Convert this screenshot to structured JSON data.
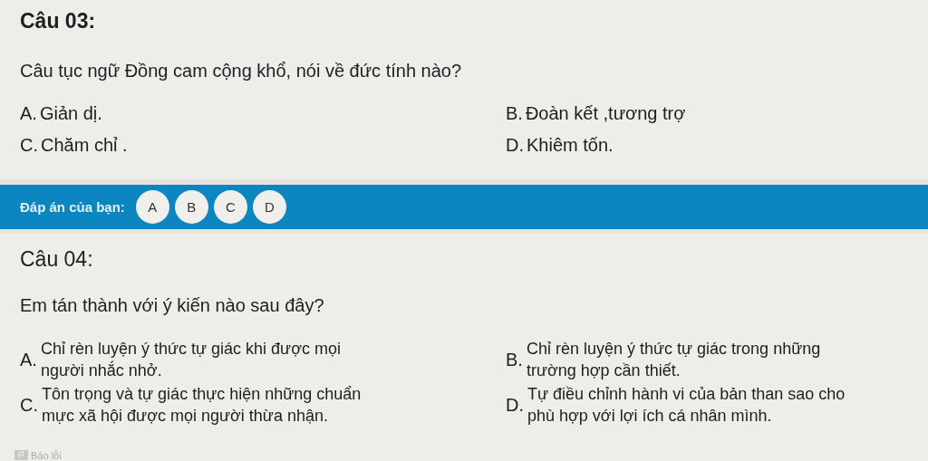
{
  "questions": [
    {
      "title": "Câu 03:",
      "title_bold": true,
      "prompt": "Câu tục ngữ Đồng cam cộng khổ, nói về đức tính nào?",
      "kind": "short",
      "options": [
        {
          "letter": "A.",
          "text": "Giản dị."
        },
        {
          "letter": "B.",
          "text": "Đoàn kết ,tương trợ"
        },
        {
          "letter": "C.",
          "text": "Chăm chỉ ."
        },
        {
          "letter": "D.",
          "text": "Khiêm tốn."
        }
      ]
    },
    {
      "title": "Câu 04:",
      "title_bold": false,
      "prompt": "Em tán thành với ý kiến nào sau đây?",
      "kind": "long",
      "options": [
        {
          "letter": "A.",
          "text": "Chỉ rèn luyện ý thức tự giác khi được mọi người nhắc nhở."
        },
        {
          "letter": "B.",
          "text": "Chỉ rèn luyện ý thức tự giác trong những trường hợp cần thiết."
        },
        {
          "letter": "C.",
          "text": "Tôn trọng và tự giác thực hiện những chuẩn mực xã hội được mọi người thừa nhận."
        },
        {
          "letter": "D.",
          "text": "Tự điều chỉnh hành vi của bản than sao cho phù hợp với lợi ích cá nhân mình."
        }
      ]
    }
  ],
  "answer_bar": {
    "label": "Đáp án của bạn:",
    "choices": [
      {
        "label": "A",
        "selected": false
      },
      {
        "label": "B",
        "selected": false
      },
      {
        "label": "C",
        "selected": false
      },
      {
        "label": "D",
        "selected": false
      }
    ]
  },
  "report_link": "Báo lỗi"
}
